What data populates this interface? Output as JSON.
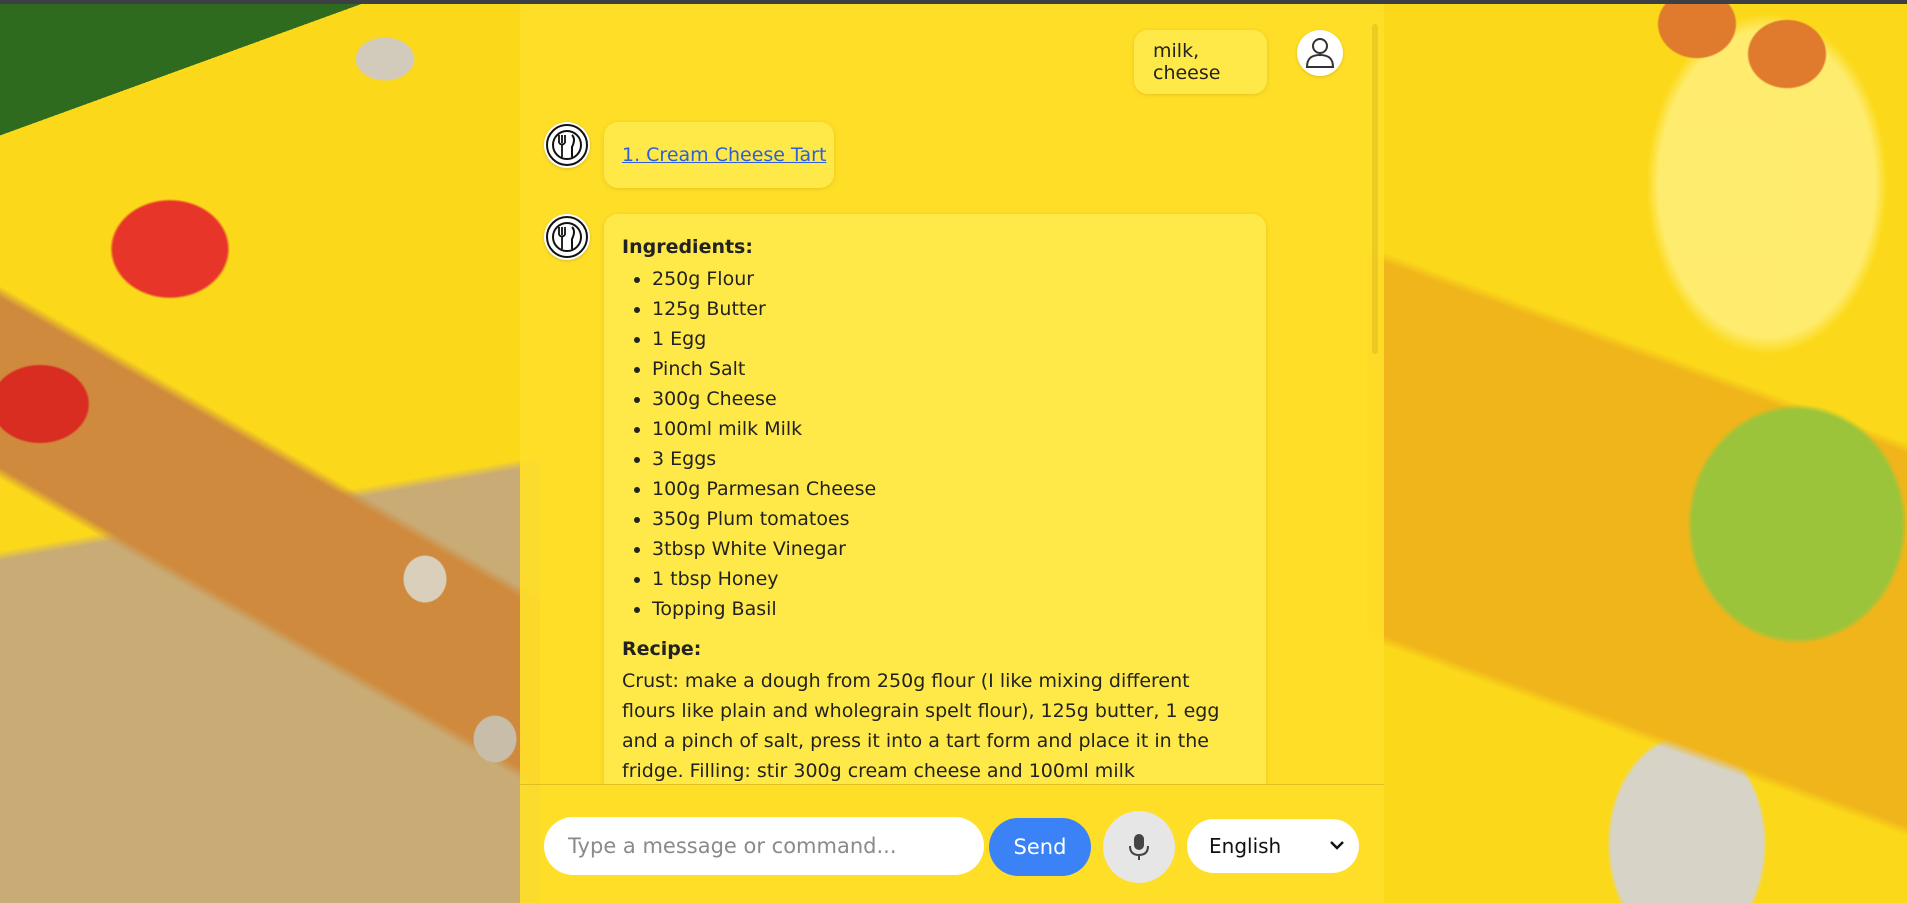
{
  "conversation": {
    "user_message": "milk, cheese",
    "bot_link": "1. Cream Cheese Tart",
    "recipe": {
      "ingredients_heading": "Ingredients:",
      "ingredients": [
        "250g Flour",
        "125g Butter",
        "1 Egg",
        "Pinch Salt",
        "300g Cheese",
        "100ml milk Milk",
        "3 Eggs",
        "100g Parmesan Cheese",
        "350g Plum tomatoes",
        "3tbsp White Vinegar",
        "1 tbsp Honey",
        "Topping Basil"
      ],
      "recipe_heading": "Recipe:",
      "recipe_text": "Crust: make a dough from 250g flour (I like mixing different flours like plain and wholegrain spelt flour), 125g butter, 1 egg and a pinch of salt, press it into a tart form and place it in the fridge. Filling: stir 300g cream cheese and 100ml milk"
    }
  },
  "composer": {
    "placeholder": "Type a message or command...",
    "send_label": "Send",
    "language": "English"
  },
  "icons": {
    "user_avatar": "user-icon",
    "bot_avatar": "fork-knife-icon",
    "mic": "microphone-icon",
    "dropdown": "chevron-down-icon"
  },
  "colors": {
    "background": "#fbd91a",
    "send_button": "#3b82f6",
    "link": "#2d5fd8"
  }
}
